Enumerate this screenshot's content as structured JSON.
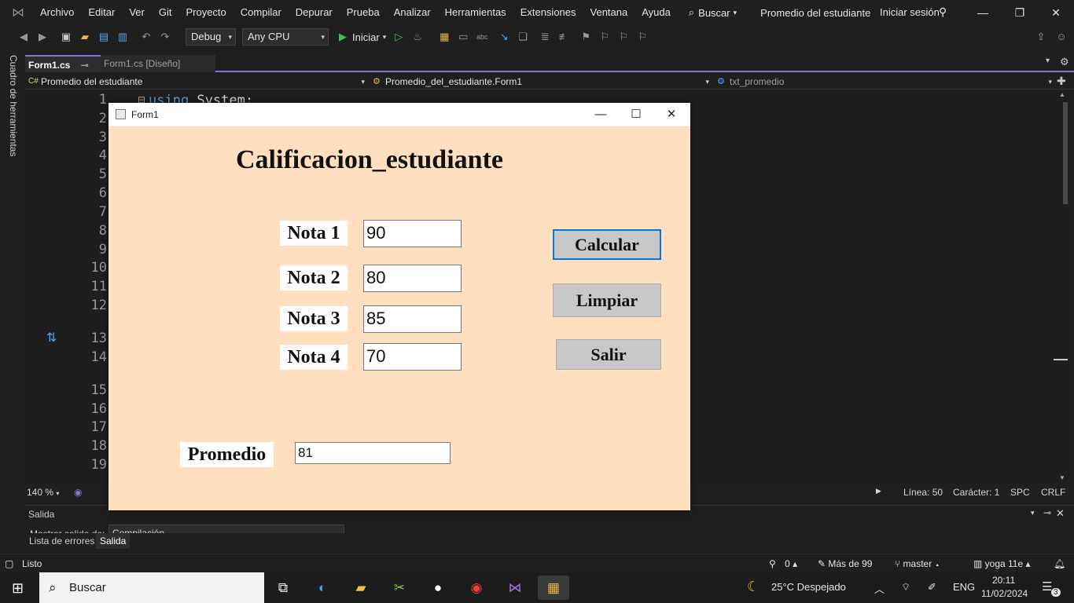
{
  "menubar": {
    "items": [
      "Archivo",
      "Editar",
      "Ver",
      "Git",
      "Proyecto",
      "Compilar",
      "Depurar",
      "Prueba",
      "Analizar",
      "Herramientas",
      "Extensiones",
      "Ventana",
      "Ayuda"
    ],
    "search_label": "Buscar",
    "solution_title": "Promedio del estudiante",
    "signin_label": "Iniciar sesión"
  },
  "toolbar": {
    "config": "Debug",
    "platform": "Any CPU",
    "start_label": "Iniciar"
  },
  "toolbox": {
    "label": "Cuadro de herramientas"
  },
  "tabs": [
    {
      "label": "Form1.cs",
      "active": true
    },
    {
      "label": "Form1.cs [Diseño]",
      "active": false
    }
  ],
  "navbar": {
    "project": "Promedio del estudiante",
    "class": "Promedio_del_estudiante.Form1",
    "member": "txt_promedio"
  },
  "editor": {
    "line_numbers": [
      "1",
      "2",
      "3",
      "4",
      "5",
      "6",
      "7",
      "8",
      "9",
      "10",
      "11",
      "12",
      "13",
      "14",
      "15",
      "16",
      "17",
      "18",
      "19"
    ],
    "first_line_keyword": "using",
    "first_line_rest": " System;"
  },
  "editor_status": {
    "zoom": "140 %",
    "line": "Línea: 50",
    "char": "Carácter: 1",
    "spc": "SPC",
    "crlf": "CRLF"
  },
  "output": {
    "title": "Salida",
    "show_from_label": "Mostrar salida de:",
    "show_from_value": "Compilación"
  },
  "bottom_tabs": [
    "Lista de errores",
    "Salida"
  ],
  "statusbar": {
    "ready": "Listo",
    "errors": "0",
    "changes": "Más de 99",
    "branch": "master",
    "repo": "yoga 11e"
  },
  "taskbar": {
    "search": "Buscar",
    "weather": "25°C  Despejado",
    "lang": "ENG",
    "time": "20:11",
    "date": "11/02/2024",
    "notifications": "3"
  },
  "form1": {
    "title": "Form1",
    "heading": "Calificacion_estudiante",
    "notas": [
      {
        "label": "Nota 1",
        "value": "90"
      },
      {
        "label": "Nota 2",
        "value": "80"
      },
      {
        "label": "Nota 3",
        "value": "85"
      },
      {
        "label": "Nota 4",
        "value": "70"
      }
    ],
    "buttons": {
      "calcular": "Calcular",
      "limpiar": "Limpiar",
      "salir": "Salir"
    },
    "promedio_label": "Promedio",
    "promedio_value": "81",
    "background": "#ffdfc0"
  },
  "colors": {
    "accent": "#8d6fd6",
    "focus": "#0078d7"
  }
}
